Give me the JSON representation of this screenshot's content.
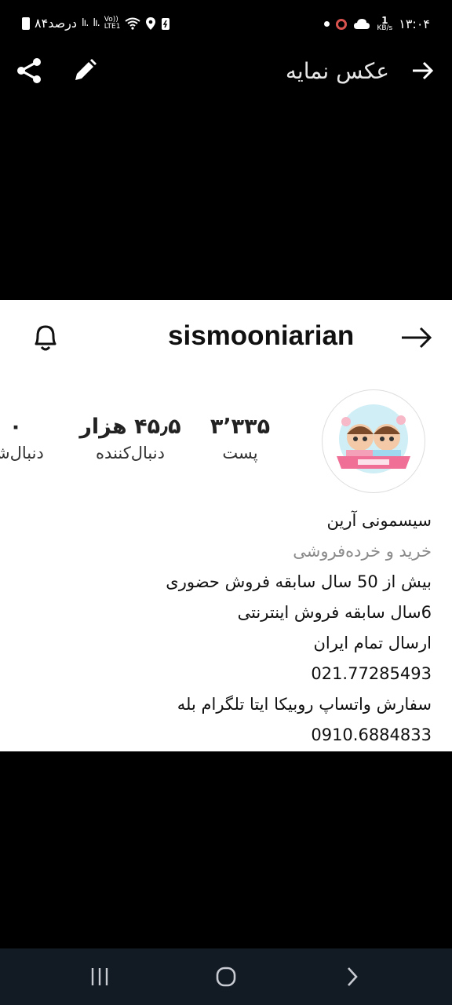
{
  "status_bar": {
    "battery_text": "۸۴درصد",
    "signal_1": "lı.",
    "signal_2": "lı.",
    "volte_top": "Vo))",
    "volte_bottom": "LTE1",
    "net_speed_value": "1",
    "net_speed_unit": "KB/s",
    "time": "۱۳:۰۴"
  },
  "app_bar": {
    "title": "عکس نمایه"
  },
  "photo": {
    "username": "sismooniarian",
    "stats": {
      "posts_value": "۳٬۳۳۵",
      "posts_label": "پست",
      "followers_value": "۴۵٫۵ هزار",
      "followers_label": "دنبال‌کننده",
      "following_value": "۰",
      "following_label": "دنبال‌شو"
    },
    "bio": {
      "name": "سیسمونی آرین",
      "category": "خرید و خرده‌فروشی",
      "line1": "بیش از 50 سال سابقه فروش حضوری",
      "line2": "6سال سابقه فروش اینترنتی",
      "line3": "ارسال تمام ایران",
      "line4": "021.77285493",
      "line5": "سفارش واتساپ روبیکا ایتا تلگرام بله",
      "line6": "0910.6884833"
    }
  },
  "colors": {
    "background": "#000000",
    "nav_bar": "#121a24",
    "photo_bg": "#ffffff"
  }
}
